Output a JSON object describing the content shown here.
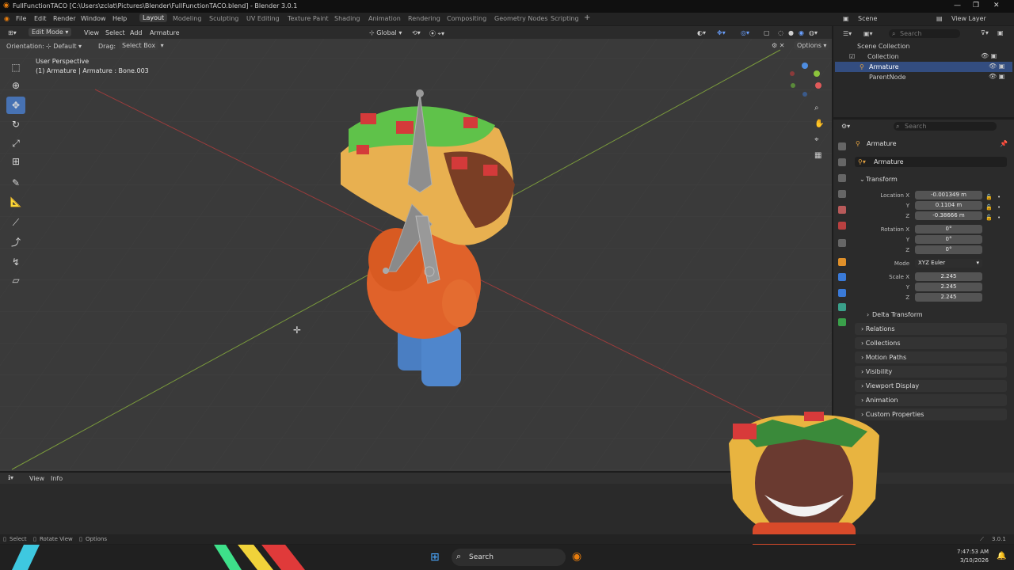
{
  "titlebar": {
    "title": "FullFunctionTACO [C:\\Users\\zclat\\Pictures\\Blender\\FullFunctionTACO.blend] - Blender 3.0.1"
  },
  "menubar": {
    "menus": [
      "File",
      "Edit",
      "Render",
      "Window",
      "Help"
    ],
    "workspaces": [
      "Layout",
      "Modeling",
      "Sculpting",
      "UV Editing",
      "Texture Paint",
      "Shading",
      "Animation",
      "Rendering",
      "Compositing",
      "Geometry Nodes",
      "Scripting"
    ],
    "active_workspace": "Layout",
    "scene_label": "Scene",
    "viewlayer_label": "View Layer"
  },
  "viewport_header": {
    "mode": "Edit Mode",
    "menus": [
      "View",
      "Select",
      "Add",
      "Armature"
    ],
    "orientation_space": "Global",
    "options": "Options"
  },
  "tool_header": {
    "orientation_label": "Orientation:",
    "orientation_value": "Default",
    "drag_label": "Drag:",
    "drag_value": "Select Box"
  },
  "viewport": {
    "view_name": "User Perspective",
    "context_line": "(1) Armature | Armature : Bone.003"
  },
  "outliner": {
    "search_placeholder": "Search",
    "items": [
      "Scene Collection",
      "Collection",
      "Armature",
      "ParentNode"
    ]
  },
  "properties": {
    "search_placeholder": "Search",
    "object_name": "Armature",
    "data_name": "Armature",
    "transform_label": "Transform",
    "location_label": "Location X",
    "location": [
      "-0.001349 m",
      "0.1104 m",
      "-0.38666 m"
    ],
    "rotation_label": "Rotation X",
    "rotation": [
      "0°",
      "0°",
      "0°"
    ],
    "mode_label": "Mode",
    "mode_value": "XYZ Euler",
    "scale_label": "Scale X",
    "scale": [
      "2.245",
      "2.245",
      "2.245"
    ],
    "axis_y": "Y",
    "axis_z": "Z",
    "panels": [
      "Delta Transform",
      "Relations",
      "Collections",
      "Motion Paths",
      "Visibility",
      "Viewport Display",
      "Animation",
      "Custom Properties"
    ]
  },
  "timeline": {
    "menus": [
      "View",
      "Info"
    ]
  },
  "statusbar": {
    "items": [
      "Select",
      "Rotate View",
      "Options"
    ],
    "version": "3.0.1"
  },
  "taskbar": {
    "search_label": "Search",
    "time": "7:47:53 AM",
    "date": "3/10/2026"
  }
}
